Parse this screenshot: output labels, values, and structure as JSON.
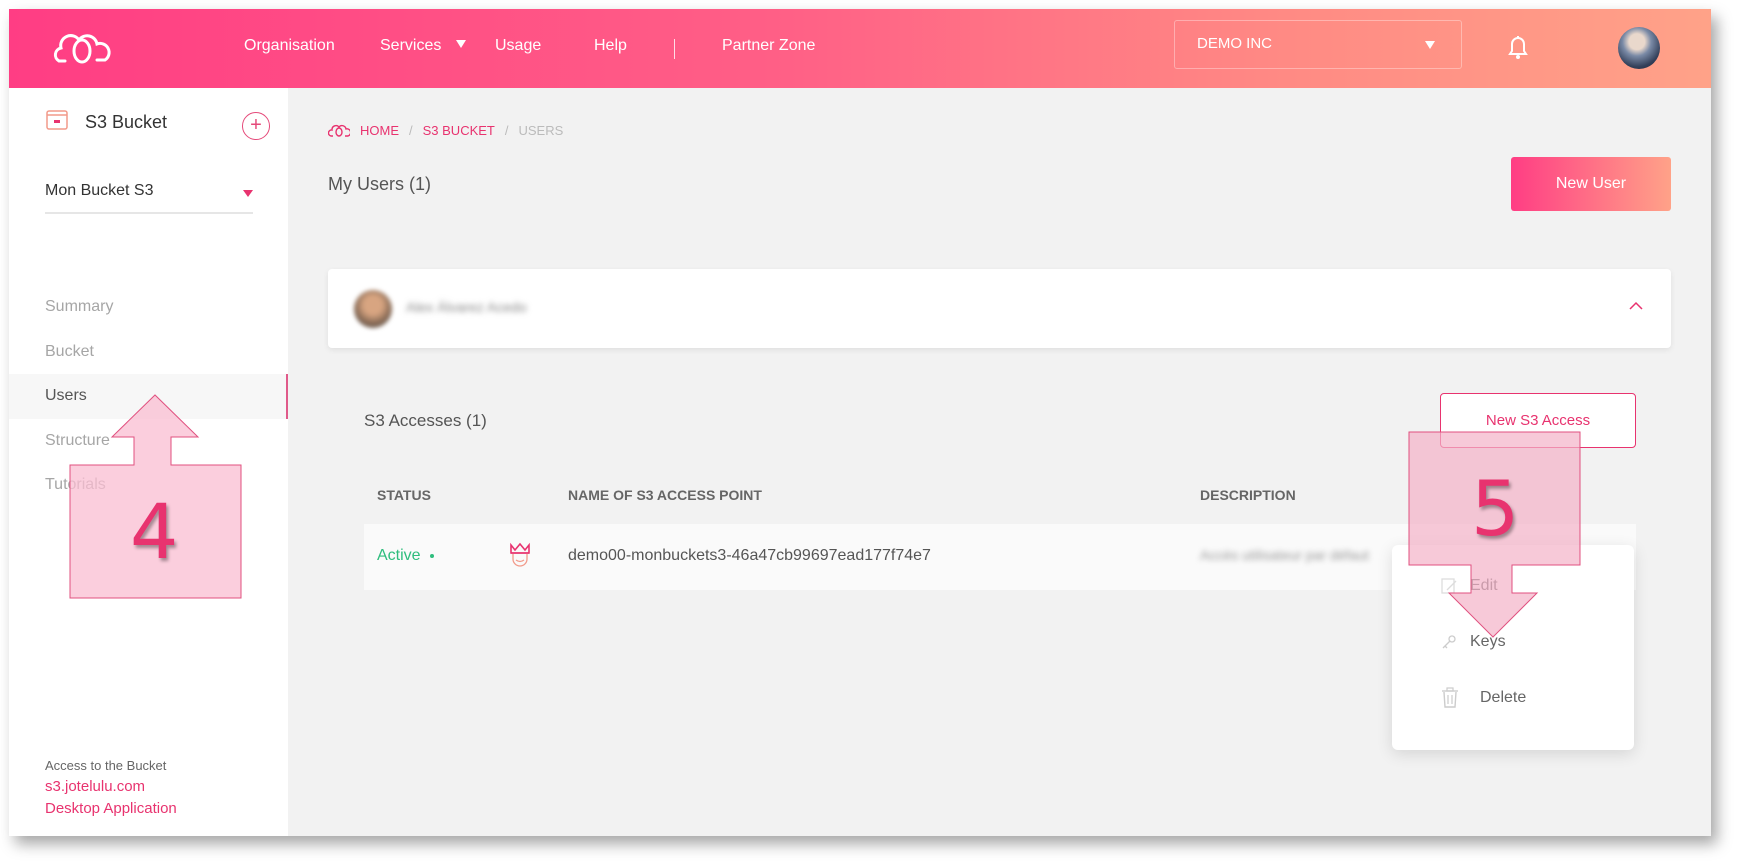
{
  "header": {
    "logo": "cloud-logo-icon",
    "nav": [
      {
        "label": "Organisation"
      },
      {
        "label": "Services",
        "has_dropdown": true
      },
      {
        "label": "Usage"
      },
      {
        "label": "Help"
      },
      {
        "label": "Partner Zone"
      }
    ],
    "org_select": {
      "value": "DEMO INC"
    },
    "icons": {
      "notifications": "bell-icon",
      "user": "avatar"
    }
  },
  "sidebar": {
    "title": "S3 Bucket",
    "add_label": "+",
    "bucket_select": {
      "value": "Mon Bucket S3"
    },
    "items": [
      {
        "label": "Summary",
        "active": false
      },
      {
        "label": "Bucket",
        "active": false
      },
      {
        "label": "Users",
        "active": true
      },
      {
        "label": "Structure",
        "active": false
      },
      {
        "label": "Tutorials",
        "active": false
      }
    ],
    "footer": {
      "label": "Access to the Bucket",
      "links": [
        "s3.jotelulu.com",
        "Desktop Application"
      ]
    }
  },
  "main": {
    "breadcrumb": [
      {
        "label": "HOME",
        "link": true
      },
      {
        "label": "S3 BUCKET",
        "link": true
      },
      {
        "label": "USERS",
        "link": false
      }
    ],
    "title": "My Users (1)",
    "new_user_label": "New User",
    "user": {
      "name": "Alex Álvarez Acedo",
      "blurred": true
    },
    "accesses": {
      "title": "S3 Accesses (1)",
      "new_access_label": "New S3 Access",
      "columns": [
        "STATUS",
        "NAME OF S3 ACCESS POINT",
        "DESCRIPTION"
      ],
      "rows": [
        {
          "status": "Active",
          "icon": "crown-avatar-icon",
          "name": "demo00-monbuckets3-46a47cb99697ead177f74e7",
          "description": "Accès utilisateur par défaut",
          "description_blurred": true
        }
      ]
    },
    "row_menu": [
      {
        "label": "Edit",
        "icon": "edit-icon"
      },
      {
        "label": "Keys",
        "icon": "key-icon"
      },
      {
        "label": "Delete",
        "icon": "trash-icon"
      }
    ]
  },
  "annotations": [
    {
      "number": "4",
      "direction": "up",
      "target": "Users"
    },
    {
      "number": "5",
      "direction": "down",
      "target": "Keys"
    }
  ],
  "colors": {
    "accent": "#e8336f",
    "gradient_start": "#ff3d84",
    "gradient_end": "#ffa288",
    "status_active": "#2ebd7d",
    "annotation_fill": "#f9c6d6"
  }
}
